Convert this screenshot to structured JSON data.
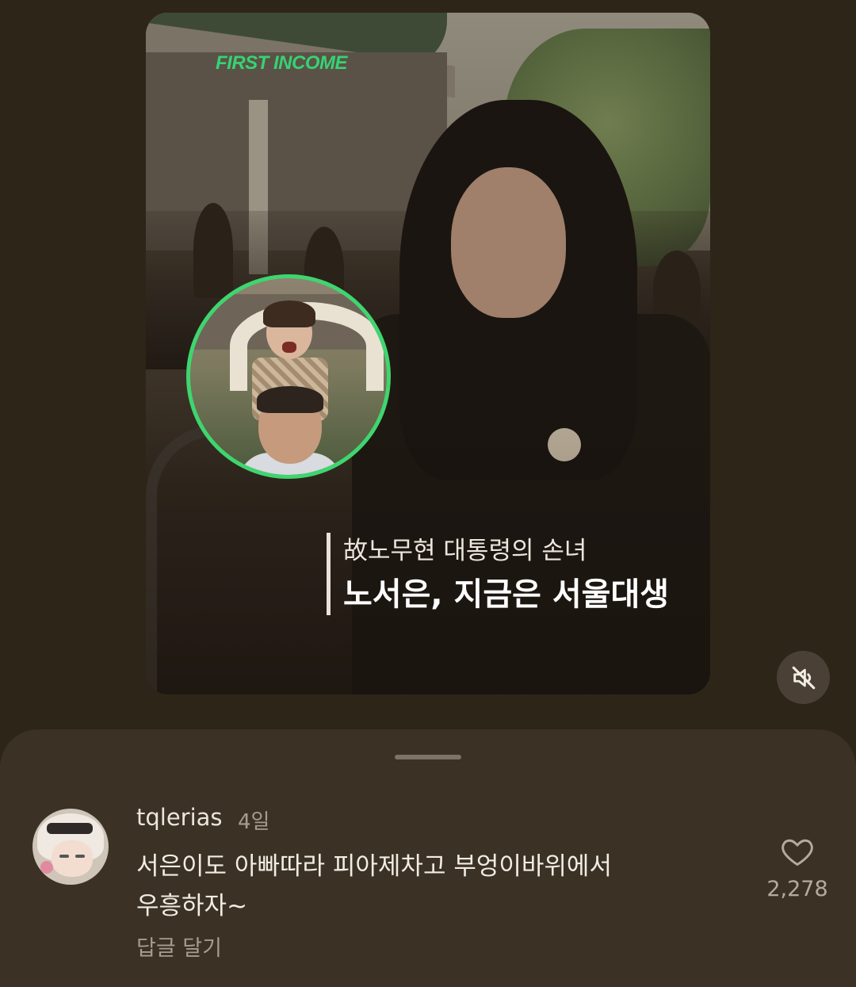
{
  "video": {
    "brand_label": "FIRST INCOME",
    "caption_sub": "故노무현 대통령의 손녀",
    "caption_main": "노서은, 지금은 서울대생",
    "accent_color": "#3fd56f",
    "mute_icon": "speaker-muted-icon"
  },
  "comments_sheet": {
    "comments": [
      {
        "username": "tqlerias",
        "time": "4일",
        "text_line1": "서은이도 아빠따라 피아제차고 부엉이바위에서",
        "text_line2": "우흥하자~",
        "reply_label": "답글 달기",
        "like_count": "2,278",
        "like_icon": "heart-outline-icon"
      }
    ]
  }
}
